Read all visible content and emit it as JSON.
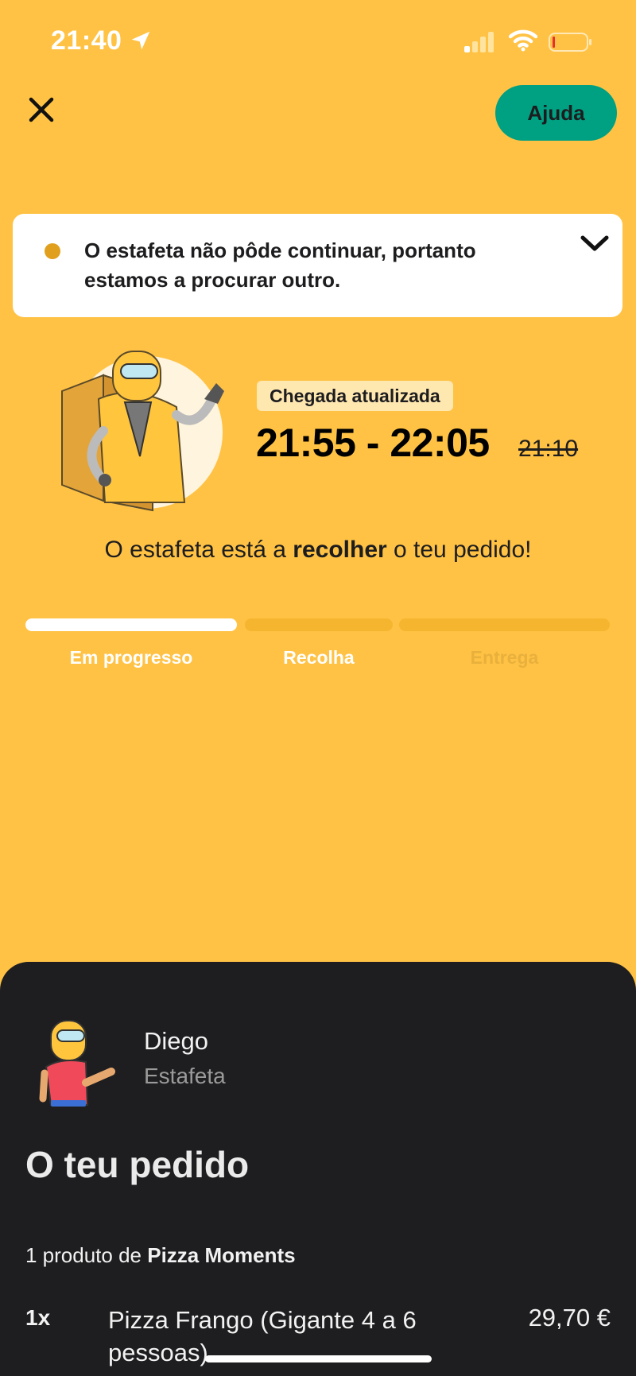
{
  "status_bar": {
    "time": "21:40"
  },
  "header": {
    "help_label": "Ajuda"
  },
  "alert": {
    "message": "O estafeta não pôde continuar, portanto estamos a procurar outro."
  },
  "eta": {
    "badge": "Chegada atualizada",
    "range": "21:55 - 22:05",
    "previous": "21:10"
  },
  "status_message": {
    "prefix": "O estafeta está a ",
    "emphasis": "recolher",
    "suffix": " o teu pedido!"
  },
  "progress": {
    "current_step": 1,
    "steps": [
      {
        "label": "Em progresso"
      },
      {
        "label": "Recolha"
      },
      {
        "label": "Entrega"
      }
    ]
  },
  "courier": {
    "name": "Diego",
    "role": "Estafeta"
  },
  "order": {
    "title": "O teu pedido",
    "count_prefix": "1 produto de ",
    "restaurant": "Pizza Moments",
    "items": [
      {
        "qty": "1x",
        "name": "Pizza Frango (Gigante 4 a 6 pessoas)",
        "price": "29,70 €"
      }
    ]
  },
  "colors": {
    "background": "#ffc244",
    "help_button": "#00a082",
    "sheet": "#1e1e20",
    "alert_dot": "#e0a01e"
  }
}
